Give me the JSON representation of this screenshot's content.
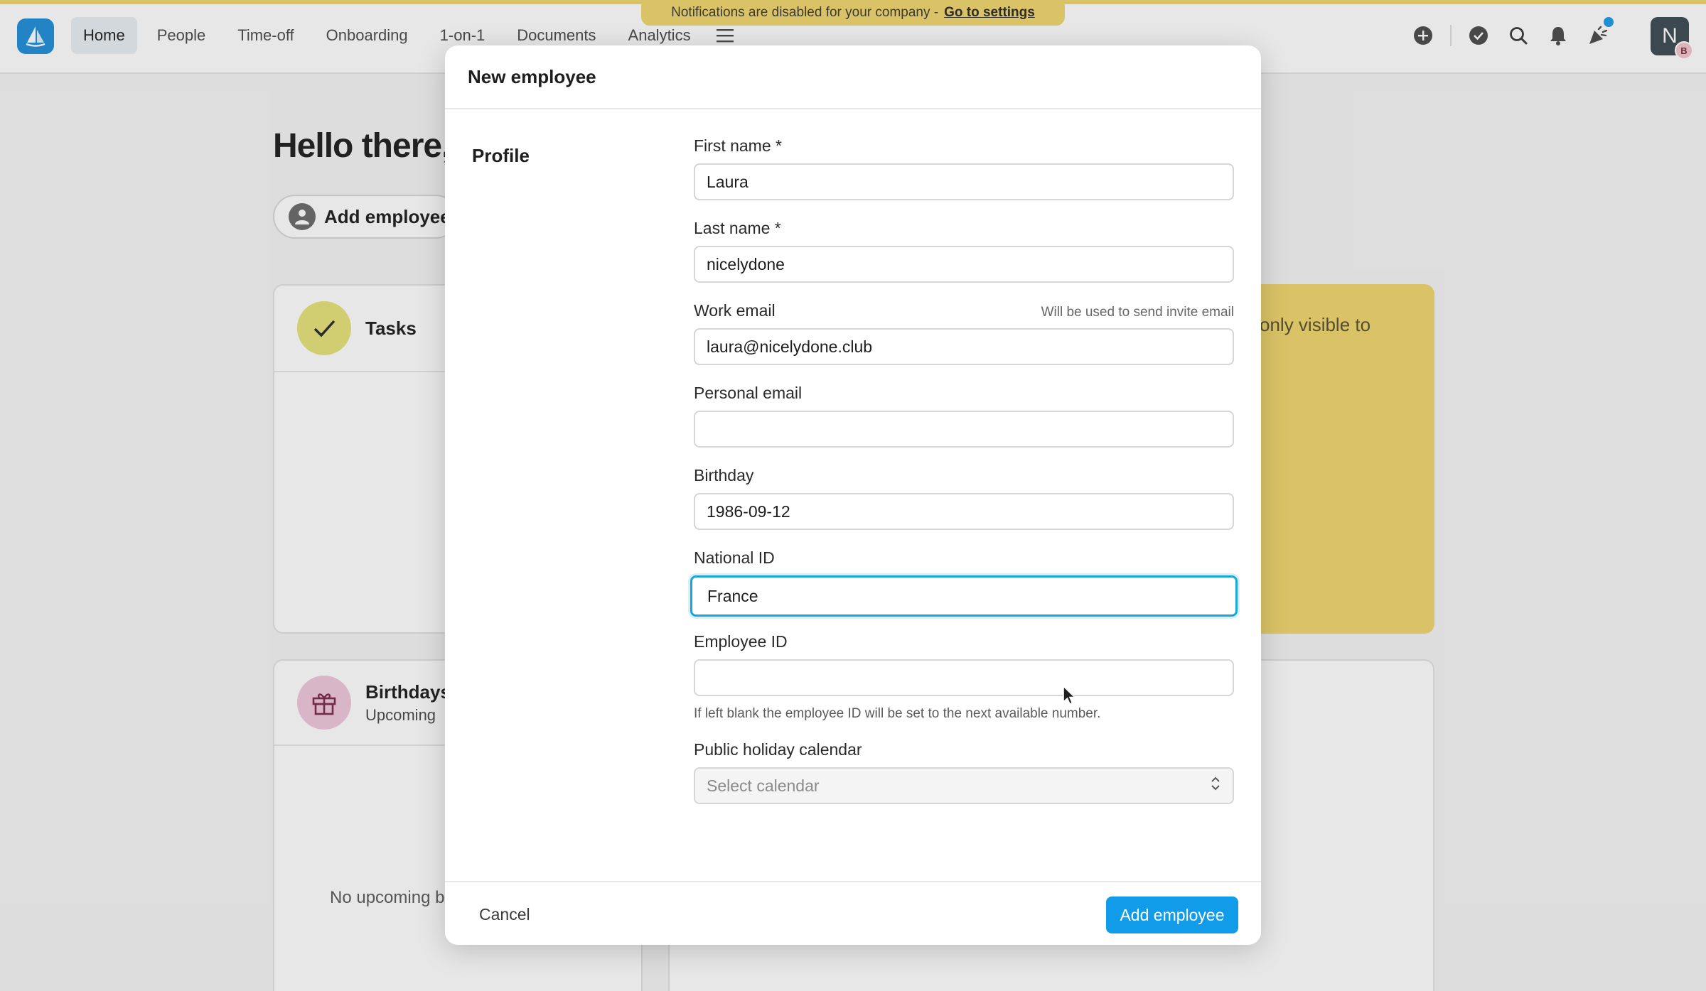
{
  "nav": {
    "items": [
      {
        "label": "Home",
        "active": true
      },
      {
        "label": "People"
      },
      {
        "label": "Time-off"
      },
      {
        "label": "Onboarding"
      },
      {
        "label": "1-on-1"
      },
      {
        "label": "Documents"
      },
      {
        "label": "Analytics"
      }
    ],
    "notice_text": "Notifications are disabled for your company -",
    "notice_link": "Go to settings",
    "avatar_initial": "N",
    "avatar_badge": "B"
  },
  "background": {
    "greeting": "Hello there,",
    "add_employee_pill": "Add employee",
    "tasks_title": "Tasks",
    "birthdays_title": "Birthdays",
    "birthdays_sub": "Upcoming",
    "yellow_text": "only visible to",
    "no_upcoming": "No upcoming b"
  },
  "modal": {
    "title": "New employee",
    "section": "Profile",
    "fields": {
      "first_name": {
        "label": "First name *",
        "value": "Laura"
      },
      "last_name": {
        "label": "Last name *",
        "value": "nicelydone"
      },
      "work_email": {
        "label": "Work email",
        "hint": "Will be used to send invite email",
        "value": "laura@nicelydone.club"
      },
      "personal_email": {
        "label": "Personal email",
        "value": ""
      },
      "birthday": {
        "label": "Birthday",
        "value": "1986-09-12"
      },
      "national_id": {
        "label": "National ID",
        "value": "France"
      },
      "employee_id": {
        "label": "Employee ID",
        "value": "",
        "helper": "If left blank the employee ID will be set to the next available number."
      },
      "holiday_calendar": {
        "label": "Public holiday calendar",
        "placeholder": "Select calendar"
      }
    },
    "cancel_label": "Cancel",
    "submit_label": "Add employee"
  },
  "colors": {
    "accent_yellow": "#f1d66d",
    "primary_blue": "#109ce8",
    "focus_blue": "#1aa6d8",
    "logo_blue": "#1f8fd8"
  }
}
